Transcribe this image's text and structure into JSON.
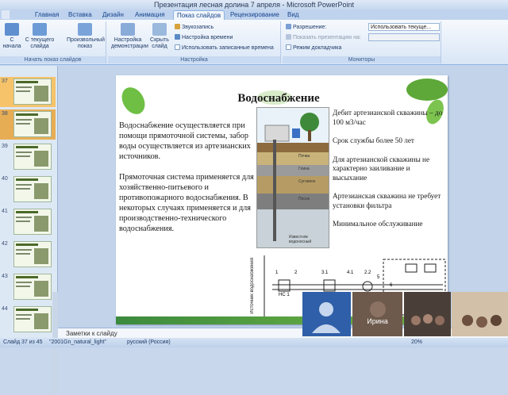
{
  "window": {
    "title": "Презентация лесная долина 7 апреля - Microsoft PowerPoint",
    "app_label": "Главная"
  },
  "tabs": [
    "Вставка",
    "Дизайн",
    "Анимация",
    "Показ слайдов",
    "Рецензирование",
    "Вид"
  ],
  "active_tab": "Показ слайдов",
  "ribbon": {
    "start_group": {
      "label": "Начать показ слайдов",
      "buttons": [
        "С начала",
        "С текущего слайда",
        "Произвольный показ"
      ]
    },
    "setup_group": {
      "label": "Настройка",
      "big": [
        "Настройка демонстрации",
        "Скрыть слайд"
      ],
      "small": [
        "Звукозапись",
        "Настройка времени",
        "Использовать записанные времена"
      ]
    },
    "monitors_group": {
      "label": "Мониторы",
      "resolution_label": "Разрешение:",
      "resolution_value": "Использовать текуще...",
      "show_on_label": "Показать презентацию на:",
      "show_on_value": "",
      "presenter_label": "Режим докладчика"
    }
  },
  "thumbnails": [
    {
      "num": "37"
    },
    {
      "num": "38"
    },
    {
      "num": "39"
    },
    {
      "num": "40"
    },
    {
      "num": "41"
    },
    {
      "num": "42"
    },
    {
      "num": "43"
    },
    {
      "num": "44"
    }
  ],
  "selected_thumb": "38",
  "slide": {
    "title": "Водоснабжение",
    "left_p1": "Водоснабжение осуществляется при помощи прямоточной системы, забор воды осуществляется из артезианских источников.",
    "left_p2": "Прямоточная система применяется для хозяйственно-питьевого и противопожарного водоснабжения. В некоторых случаях применяется и для производственно-технического водоснабжения.",
    "right": [
      "Дебит артезианской скважины – до 100 м3/час",
      "Срок службы более 50 лет",
      "Для артезианской скважины не характерно заиливание и высыхание",
      "Артезианская скважина не требует установки фильтра",
      "Минимальное обслуживание"
    ],
    "diagram_vertical": "Источник водоснабжения",
    "diagram_nodes": [
      "1",
      "2",
      "3.1",
      "4.1",
      "2.2",
      "5",
      "6",
      "НС 1"
    ],
    "diagram_layers": [
      "Почва",
      "Глина",
      "Суглинок",
      "Песок",
      "Известняк водоносный"
    ]
  },
  "notes": "Заметки к слайду",
  "status": {
    "slide": "Слайд 37 из 45",
    "theme": "\"2001Gn_natural_light\"",
    "lang": "русский (Россия)",
    "zoom": "20%"
  },
  "video": {
    "participant": "Ирина"
  }
}
